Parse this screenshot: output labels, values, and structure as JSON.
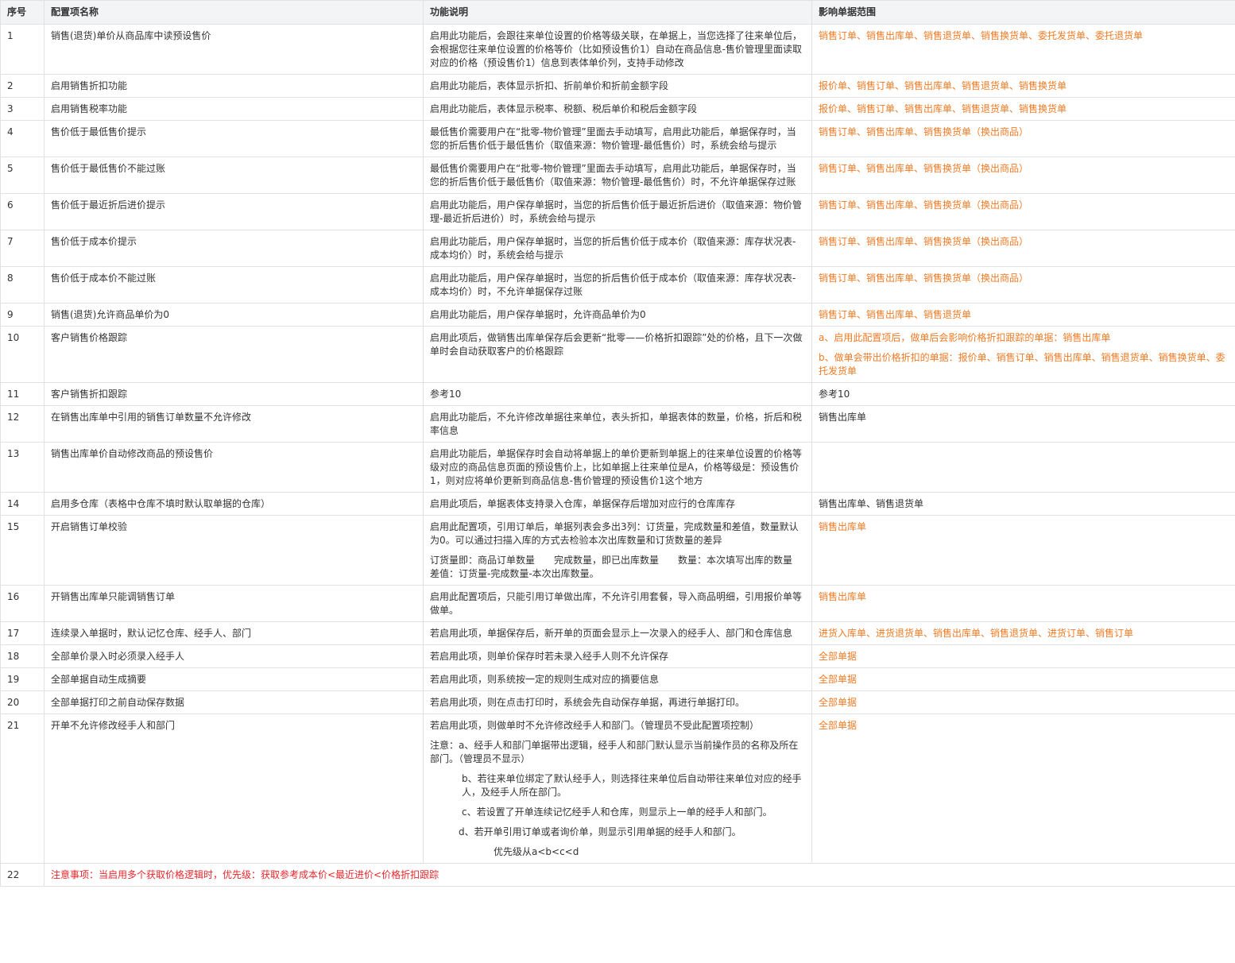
{
  "headers": [
    "序号",
    "配置项名称",
    "功能说明",
    "影响单据范围"
  ],
  "rows": [
    {
      "no": "1",
      "name": "销售(退货)单价从商品库中读预设售价",
      "desc": [
        "启用此功能后，会跟往来单位设置的价格等级关联，在单据上，当您选择了往来单位后，会根据您往来单位设置的价格等价（比如预设售价1）自动在商品信息-售价管理里面读取对应的价格（预设售价1）信息到表体单价列，支持手动修改"
      ],
      "scope": [
        "销售订单、销售出库单、销售退货单、销售换货单、委托发货单、委托退货单"
      ]
    },
    {
      "no": "2",
      "name": "启用销售折扣功能",
      "desc": [
        "启用此功能后，表体显示折扣、折前单价和折前金额字段"
      ],
      "scope": [
        "报价单、销售订单、销售出库单、销售退货单、销售换货单"
      ]
    },
    {
      "no": "3",
      "name": "启用销售税率功能",
      "desc": [
        "启用此功能后，表体显示税率、税额、税后单价和税后金额字段"
      ],
      "scope": [
        "报价单、销售订单、销售出库单、销售退货单、销售换货单"
      ]
    },
    {
      "no": "4",
      "name": "售价低于最低售价提示",
      "desc": [
        "最低售价需要用户在“批零-物价管理”里面去手动填写，启用此功能后，单据保存时，当您的折后售价低于最低售价（取值来源：物价管理-最低售价）时，系统会给与提示"
      ],
      "scope": [
        "销售订单、销售出库单、销售换货单（换出商品）"
      ]
    },
    {
      "no": "5",
      "name": "售价低于最低售价不能过账",
      "desc": [
        "最低售价需要用户在“批零-物价管理”里面去手动填写，启用此功能后，单据保存时，当您的折后售价低于最低售价（取值来源：物价管理-最低售价）时，不允许单据保存过账"
      ],
      "scope": [
        "销售订单、销售出库单、销售换货单（换出商品）"
      ]
    },
    {
      "no": "6",
      "name": "售价低于最近折后进价提示",
      "desc": [
        "启用此功能后，用户保存单据时，当您的折后售价低于最近折后进价（取值来源：物价管理-最近折后进价）时，系统会给与提示"
      ],
      "scope": [
        "销售订单、销售出库单、销售换货单（换出商品）"
      ]
    },
    {
      "no": "7",
      "name": "售价低于成本价提示",
      "desc": [
        "启用此功能后，用户保存单据时，当您的折后售价低于成本价（取值来源：库存状况表-成本均价）时，系统会给与提示"
      ],
      "scope": [
        "销售订单、销售出库单、销售换货单（换出商品）"
      ]
    },
    {
      "no": "8",
      "name": "售价低于成本价不能过账",
      "desc": [
        "启用此功能后，用户保存单据时，当您的折后售价低于成本价（取值来源：库存状况表-成本均价）时，不允许单据保存过账"
      ],
      "scope": [
        "销售订单、销售出库单、销售换货单（换出商品）"
      ]
    },
    {
      "no": "9",
      "name": "销售(退货)允许商品单价为0",
      "desc": [
        "启用此功能后，用户保存单据时，允许商品单价为0"
      ],
      "scope": [
        "销售订单、销售出库单、销售退货单"
      ]
    },
    {
      "no": "10",
      "name": "客户销售价格跟踪",
      "desc": [
        "启用此项后，做销售出库单保存后会更新“批零——价格折扣跟踪”处的价格，且下一次做单时会自动获取客户的价格跟踪"
      ],
      "scope": [
        "a、启用此配置项后，做单后会影响价格折扣跟踪的单据：销售出库单",
        "b、做单会带出价格折扣的单据：报价单、销售订单、销售出库单、销售退货单、销售换货单、委托发货单"
      ]
    },
    {
      "no": "11",
      "name": "客户销售折扣跟踪",
      "desc": [
        "参考10"
      ],
      "scope": [
        "参考10"
      ],
      "scope_plain": true
    },
    {
      "no": "12",
      "name": "在销售出库单中引用的销售订单数量不允许修改",
      "desc": [
        "启用此功能后，不允许修改单据往来单位，表头折扣，单据表体的数量，价格，折后和税率信息"
      ],
      "scope": [
        "销售出库单"
      ],
      "scope_plain": true
    },
    {
      "no": "13",
      "name": "销售出库单价自动修改商品的预设售价",
      "desc": [
        "启用此功能后，单据保存时会自动将单据上的单价更新到单据上的往来单位设置的价格等级对应的商品信息页面的预设售价上，比如单据上往来单位是A，价格等级是：预设售价1，则对应将单价更新到商品信息-售价管理的预设售价1这个地方"
      ],
      "scope": []
    },
    {
      "no": "14",
      "name": "启用多仓库（表格中仓库不填时默认取单据的仓库）",
      "desc": [
        "启用此项后，单据表体支持录入仓库，单据保存后增加对应行的仓库库存"
      ],
      "scope": [
        "销售出库单、销售退货单"
      ],
      "scope_plain": true
    },
    {
      "no": "15",
      "name": "开启销售订单校验",
      "desc": [
        "启用此配置项，引用订单后，单据列表会多出3列：订货量，完成数量和差值，数量默认为0。可以通过扫描入库的方式去检验本次出库数量和订货数量的差异",
        "订货量即：商品订单数量　　完成数量，即已出库数量　　数量：本次填写出库的数量　 差值：订货量-完成数量-本次出库数量。"
      ],
      "scope": [
        "销售出库单"
      ]
    },
    {
      "no": "16",
      "name": "开销售出库单只能调销售订单",
      "desc": [
        "启用此配置项后，只能引用订单做出库，不允许引用套餐，导入商品明细，引用报价单等做单。"
      ],
      "scope": [
        "销售出库单"
      ]
    },
    {
      "no": "17",
      "name": "连续录入单据时，默认记忆仓库、经手人、部门",
      "desc": [
        "若启用此项，单据保存后，新开单的页面会显示上一次录入的经手人、部门和仓库信息"
      ],
      "scope": [
        "进货入库单、进货退货单、销售出库单、销售退货单、进货订单、销售订单"
      ]
    },
    {
      "no": "18",
      "name": "全部单价录入时必须录入经手人",
      "desc": [
        "若启用此项，则单价保存时若未录入经手人则不允许保存"
      ],
      "scope": [
        "全部单据"
      ]
    },
    {
      "no": "19",
      "name": "全部单据自动生成摘要",
      "desc": [
        "若启用此项，则系统按一定的规则生成对应的摘要信息"
      ],
      "scope": [
        "全部单据"
      ]
    },
    {
      "no": "20",
      "name": "全部单据打印之前自动保存数据",
      "desc": [
        "若启用此项，则在点击打印时，系统会先自动保存单据，再进行单据打印。"
      ],
      "scope": [
        "全部单据"
      ]
    },
    {
      "no": "21",
      "name": "开单不允许修改经手人和部门",
      "desc": [
        "若启用此项，则做单时不允许修改经手人和部门。（管理员不受此配置项控制）",
        "注意：a、经手人和部门单据带出逻辑，经手人和部门默认显示当前操作员的名称及所在部门。（管理员不显示）",
        "b、若往来单位绑定了默认经手人，则选择往来单位后自动带往来单位对应的经手人，及经手人所在部门。",
        "c、若设置了开单连续记忆经手人和仓库，则显示上一单的经手人和部门。",
        "d、若开单引用订单或者询价单，则显示引用单据的经手人和部门。",
        "优先级从a<b<c<d"
      ],
      "scope": [
        "全部单据"
      ]
    }
  ],
  "note": {
    "no": "22",
    "text": "注意事项：当启用多个获取价格逻辑时，优先级：获取参考成本价<最近进价<价格折扣跟踪"
  },
  "colors": {
    "scope_text": "#f27a24",
    "note_text": "#e8262b",
    "header_bg": "#f3f4f6",
    "border": "#dfe2e5"
  }
}
